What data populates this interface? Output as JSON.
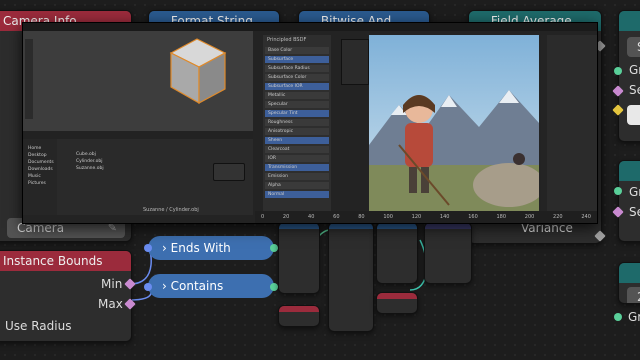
{
  "nodes": {
    "camera_info": {
      "title": "Camera Info",
      "camera_field": "Camera"
    },
    "format_string": {
      "title": "Format String"
    },
    "bitwise_and": {
      "title": "Bitwise And"
    },
    "field_average": {
      "title": "Field Average",
      "partial_label": "Variance"
    },
    "instance_bounds": {
      "title": "Instance Bounds",
      "min_label": "Min",
      "max_label": "Max",
      "use_radius_label": "Use Radius"
    },
    "ends_with": {
      "label": "Ends With"
    },
    "contains": {
      "label": "Contains"
    },
    "right_nodes": {
      "row1": "S",
      "row2": "Gr",
      "row3": "Se",
      "row4": "Gr",
      "row5": "Se",
      "row6": "2",
      "row7": "Gr"
    }
  },
  "blender_window": {
    "properties_header": "Principled BSDF",
    "properties_rows": [
      "Base Color",
      "Subsurface",
      "Subsurface Radius",
      "Subsurface Color",
      "Subsurface IOR",
      "Metallic",
      "Specular",
      "Specular Tint",
      "Roughness",
      "Anisotropic",
      "Sheen",
      "Clearcoat",
      "IOR",
      "Transmission",
      "Emission",
      "Alpha",
      "Normal"
    ],
    "file_browser_items": [
      "Cube.obj",
      "Cylinder.obj",
      "Suzanne.obj"
    ],
    "file_browser_places": [
      "Home",
      "Desktop",
      "Documents",
      "Downloads",
      "Music",
      "Pictures"
    ],
    "status_text": "Suzanne / Cylinder.obj",
    "timeline_frames": [
      "0",
      "20",
      "40",
      "60",
      "80",
      "100",
      "120",
      "140",
      "160",
      "180",
      "200",
      "220",
      "240"
    ]
  },
  "colors": {
    "red_header": "#9b2b3c",
    "blue_header": "#2a5a8f",
    "teal_header": "#1e6a6a",
    "pill": "#3d6fb0"
  }
}
